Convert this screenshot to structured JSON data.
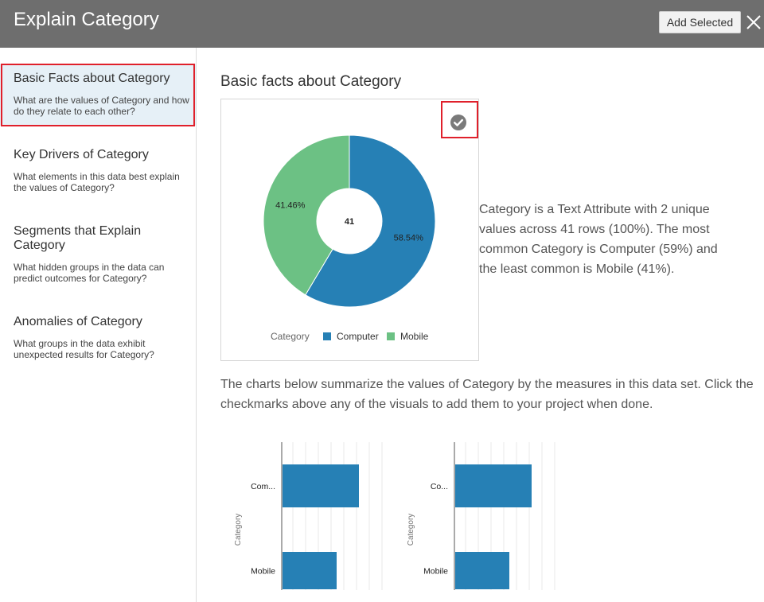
{
  "header": {
    "title": "Explain Category",
    "add_selected_label": "Add Selected",
    "close_icon": "close-icon"
  },
  "sidebar": {
    "items": [
      {
        "name": "Basic Facts about Category",
        "desc": "What are the values of Category and how do they relate to each other?",
        "selected": true
      },
      {
        "name": "Key Drivers of Category",
        "desc": "What elements in this data best explain the values of Category?",
        "selected": false
      },
      {
        "name": "Segments that Explain Category",
        "desc": "What hidden groups in the data can predict outcomes for Category?",
        "selected": false
      },
      {
        "name": "Anomalies of Category",
        "desc": "What groups in the data exhibit unexpected results for Category?",
        "selected": false
      }
    ]
  },
  "main": {
    "title": "Basic facts about Category",
    "description": "Category is a Text Attribute with 2 unique values across 41 rows (100%). The most common Category is Computer (59%) and the least common is Mobile (41%).",
    "summary": "The charts below summarize the values of Category by the measures in this data set. Click the checkmarks above any of the visuals to add them to your project when done.",
    "check_icon": "check-circle-icon"
  },
  "colors": {
    "computer": "#2680b5",
    "mobile": "#6cc184",
    "header_bg": "#6e6e6e",
    "highlight": "#e0202b"
  },
  "chart_data": [
    {
      "type": "pie",
      "variant": "donut",
      "center_label": "41",
      "legend_title": "Category",
      "legend_position": "bottom",
      "categories": [
        "Computer",
        "Mobile"
      ],
      "values": [
        58.54,
        41.46
      ],
      "data_labels": [
        "58.54%",
        "41.46%"
      ]
    },
    {
      "type": "bar",
      "orientation": "horizontal",
      "ylabel": "Category",
      "categories": [
        "Com...",
        "Mobile"
      ],
      "values": [
        24,
        17
      ]
    },
    {
      "type": "bar",
      "orientation": "horizontal",
      "ylabel": "Category",
      "categories": [
        "Co...",
        "Mobile"
      ],
      "values": [
        24,
        17
      ]
    }
  ]
}
